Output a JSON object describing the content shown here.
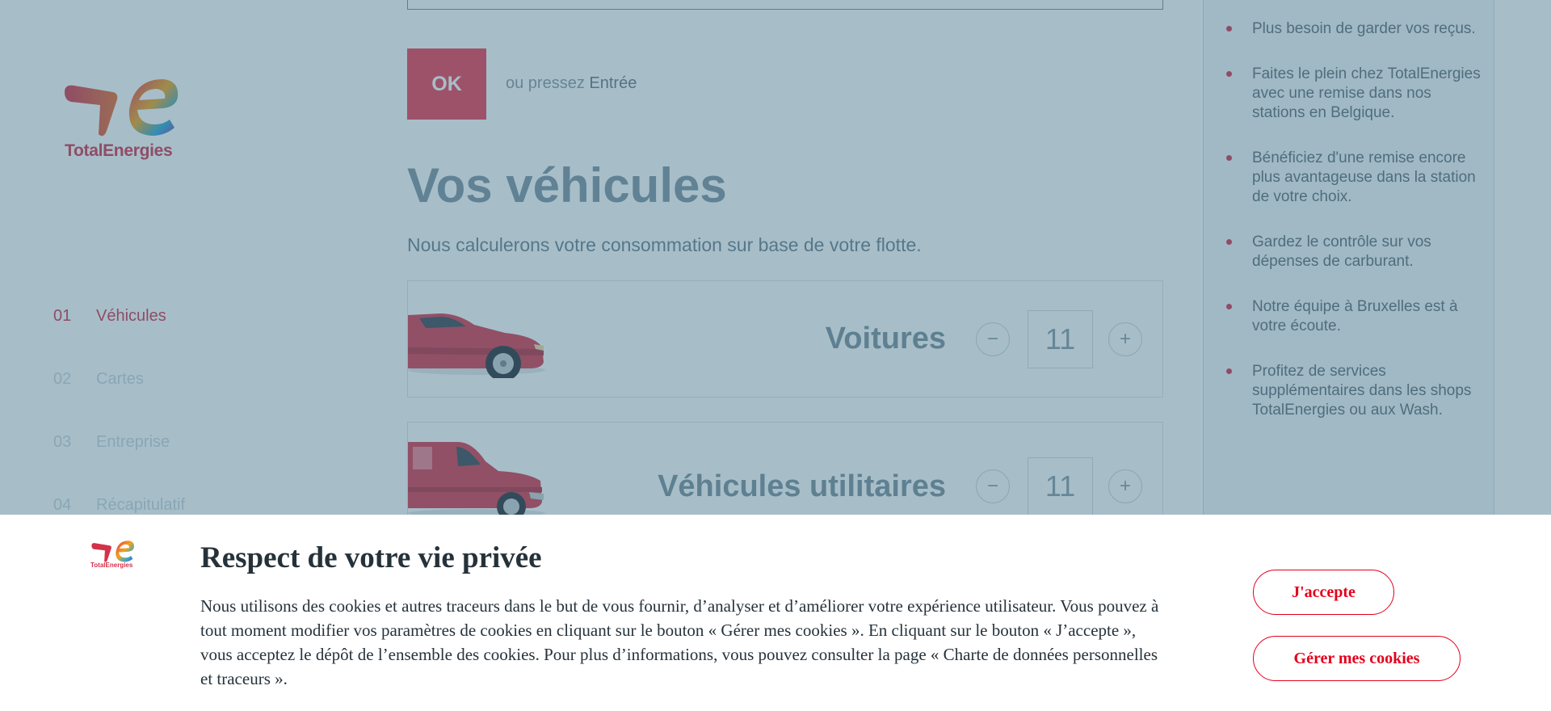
{
  "brand": {
    "name": "TotalEnergies",
    "color": "#d4314a",
    "logo_icon": "totalenergies-logo-icon"
  },
  "steps": [
    {
      "num": "01",
      "label": "Véhicules",
      "state": "active"
    },
    {
      "num": "02",
      "label": "Cartes",
      "state": "inactive"
    },
    {
      "num": "03",
      "label": "Entreprise",
      "state": "inactive"
    },
    {
      "num": "04",
      "label": "Récapitulatif",
      "state": "inactive"
    }
  ],
  "form": {
    "ok_label": "OK",
    "hint_prefix": "ou pressez",
    "hint_key": "Entrée"
  },
  "vehicles": {
    "title": "Vos véhicules",
    "subtitle": "Nous calculerons votre consommation sur base de votre flotte.",
    "items": [
      {
        "label": "Voitures",
        "quantity": "11",
        "image": "red-car-illustration",
        "minus": "−",
        "plus": "+"
      },
      {
        "label": "Véhicules utilitaires",
        "quantity": "11",
        "image": "red-van-illustration",
        "minus": "−",
        "plus": "+"
      }
    ]
  },
  "benefits": [
    "Plus besoin de garder vos reçus.",
    "Faites le plein chez TotalEnergies avec une remise dans nos stations en Belgique.",
    "Bénéficiez d'une remise encore plus avantageuse dans la station de votre choix.",
    "Gardez le contrôle sur vos dépenses de carburant.",
    "Notre équipe à Bruxelles est à votre écoute.",
    "Profitez de services supplémentaires dans les shops TotalEnergies ou aux Wash."
  ],
  "cookie": {
    "title": "Respect de votre vie privée",
    "text": "Nous utilisons des cookies et autres traceurs dans le but de vous fournir, d’analyser et d’améliorer votre expérience utilisateur. Vous pouvez à tout moment modifier vos paramètres de cookies en cliquant sur le bouton « Gérer mes cookies ». En cliquant sur le bouton « J’accepte », vous acceptez le dépôt de l’ensemble des cookies. Pour plus d’informations, vous pouvez consulter la page « Charte de données personnelles et traceurs ».",
    "accept_label": "J'accepte",
    "manage_label": "Gérer mes cookies",
    "button_color": "#e4001b"
  }
}
